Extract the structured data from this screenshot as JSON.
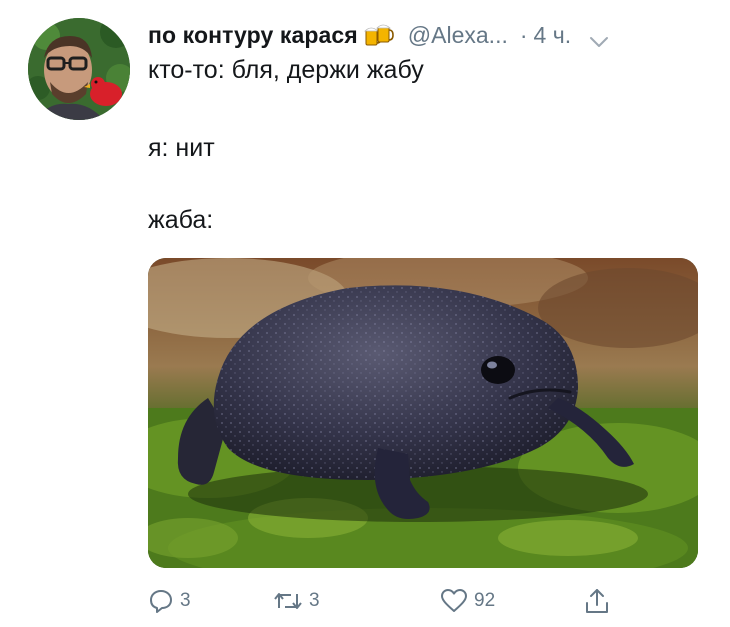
{
  "tweet": {
    "author": {
      "display_name": "по контуру карася",
      "emoji_icon": "beer-mugs-icon",
      "handle": "@Alexa...",
      "separator": "·",
      "time": "4 ч."
    },
    "text": {
      "line1": "кто-то: бля, держи жабу",
      "line2": "я: нит",
      "line3": "жаба:"
    },
    "media": {
      "subject": "black rain frog on moss"
    },
    "actions": {
      "reply_count": "3",
      "retweet_count": "3",
      "like_count": "92"
    }
  },
  "colors": {
    "text": "#14171a",
    "secondary": "#657786",
    "background": "#ffffff"
  }
}
